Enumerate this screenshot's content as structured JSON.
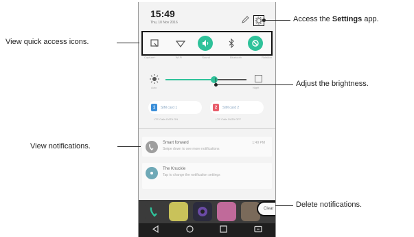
{
  "status": {
    "time": "15:49",
    "date": "Thu, 10 Nov 2016"
  },
  "header_icons": [
    "pencil-icon",
    "gear-icon"
  ],
  "quick_access": {
    "items": [
      {
        "icon": "screen-capture-icon",
        "label": "Capture+",
        "active": false
      },
      {
        "icon": "wifi-icon",
        "label": "Wi-Fi",
        "active": false
      },
      {
        "icon": "sound-icon",
        "label": "Sound",
        "active": true
      },
      {
        "icon": "bluetooth-icon",
        "label": "Bluetooth",
        "active": false
      },
      {
        "icon": "rotation-icon",
        "label": "Rotation",
        "active": true
      }
    ]
  },
  "brightness": {
    "level": 0.6,
    "auto_label": "Auto",
    "end_label": "Night"
  },
  "sim": [
    {
      "tag": "1",
      "label": "SIM card 1",
      "sub": "LTE  Calls  DATA ON",
      "color": "#3b8fd9"
    },
    {
      "tag": "2",
      "label": "SIM card 2",
      "sub": "LTE  Calls  DATA OFF",
      "color": "#e85c6a"
    }
  ],
  "notifications": [
    {
      "title": "Smart forward",
      "body": "Swipe down to see more notifications",
      "time": "1:49 PM"
    },
    {
      "title": "The Knuckle",
      "body": "Tap to change the notification settings",
      "time": ""
    }
  ],
  "clear_label": "Clear",
  "callouts": {
    "settings_pre": "Access the ",
    "settings_bold": "Settings",
    "settings_post": " app.",
    "quick_access": "View quick access icons.",
    "brightness": "Adjust the brightness.",
    "notifications": "View notifications.",
    "delete": "Delete notifications."
  },
  "colors": {
    "accent": "#2fc29a",
    "dark": "#222222",
    "phone_bg": "#f3f3f3"
  }
}
